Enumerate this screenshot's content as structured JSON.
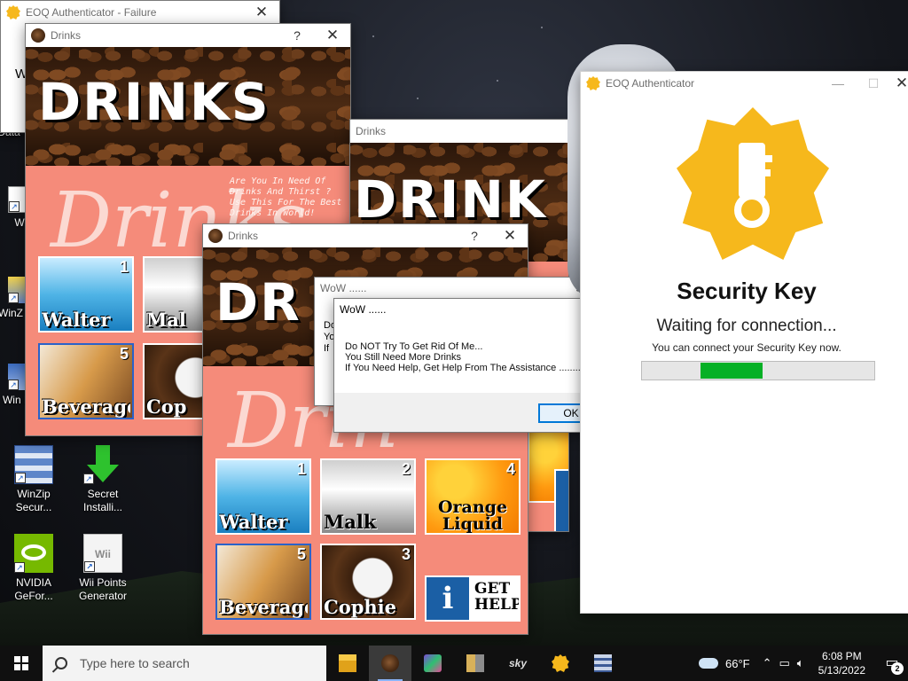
{
  "desktop": {
    "icons": [
      {
        "label": "Data",
        "icon": "data-file-icon"
      },
      {
        "label": "W",
        "icon": "word-doc-icon"
      },
      {
        "label": "WinZ Ma",
        "icon": "winzip-icon"
      },
      {
        "label": "Win Ex",
        "icon": "winzip-ex-icon"
      },
      {
        "label": "WinZip Secur...",
        "icon": "winzip-secure-icon"
      },
      {
        "label": "Secret Installi...",
        "icon": "green-download-arrow-icon"
      },
      {
        "label": "NVIDIA GeFor...",
        "icon": "nvidia-icon"
      },
      {
        "label": "Wii Points Generator",
        "icon": "wii-points-icon"
      }
    ]
  },
  "failure_window": {
    "title": "EOQ Authenticator - Failure",
    "body_text": "W"
  },
  "drinks_app": {
    "title": "Drinks",
    "help_btn": "?",
    "close_btn": "✕",
    "banner_title": "DRINKS",
    "banner_title_partial_2": "DRINK",
    "banner_title_partial_3": "DR",
    "script_text": "Drinks",
    "script_text_partial": "Drin",
    "slogan": "Are You In Need Of Drinks And Thirst ? Use This For The Best Drinks In World!",
    "tiles": [
      {
        "num": "1",
        "label": "Walter"
      },
      {
        "num": "2",
        "label": "Malk"
      },
      {
        "num": "4",
        "label": "Orange Liquid"
      },
      {
        "num": "5",
        "label": "Beverage"
      },
      {
        "num": "3",
        "label": "Cophie"
      },
      {
        "label": "GET HELP",
        "icon": "info-icon",
        "icon_text": "i"
      }
    ],
    "partial_labels": {
      "walter": "Walter",
      "malk": "Mal",
      "beverage": "Beverage",
      "cophie": "Cop"
    }
  },
  "wow_back": {
    "title": "WoW ......",
    "line1": "Do",
    "line2": "You",
    "line3": "If"
  },
  "wow_dialog": {
    "title": "WoW ......",
    "lines": [
      "Do NOT Try To Get Rid Of Me...",
      "You Still Need More Drinks",
      "If You Need Help, Get Help From The Assistance ..........."
    ],
    "ok": "OK"
  },
  "lt_glyph": "<",
  "security": {
    "title": "EOQ Authenticator",
    "heading": "Security Key",
    "waiting": "Waiting for connection...",
    "hint": "You can connect your Security Key now.",
    "progress": 0.52,
    "progress_start": 0.25,
    "minimize": "—",
    "maximize": "☐",
    "close": "✕"
  },
  "taskbar": {
    "search_placeholder": "Type here to search",
    "apps": [
      "file-explorer-icon",
      "drinks-coffee-icon",
      "game-app-icon",
      "archive-app-icon",
      "sky-app-icon",
      "eoq-authenticator-icon",
      "winzip-app-icon"
    ],
    "sky_label": "sky",
    "weather": "66°F",
    "time": "6:08 PM",
    "date": "5/13/2022",
    "notifications": "2"
  },
  "colors": {
    "salmon": "#f58b7a",
    "accent": "#0078d7",
    "key_gold": "#f6b81c",
    "progress_green": "#06b025"
  }
}
